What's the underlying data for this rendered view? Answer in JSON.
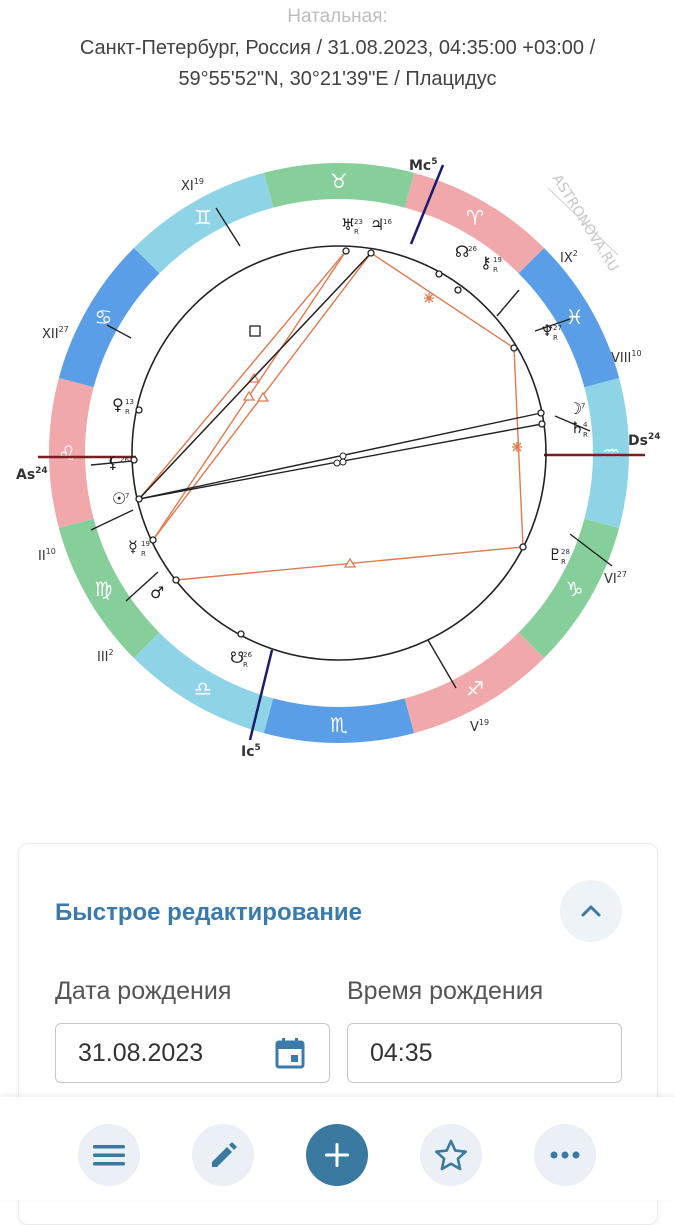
{
  "header": {
    "kind": "Натальная:",
    "line1": "Санкт-Петербург, Россия / 31.08.2023, 04:35:00 +03:00 /",
    "line2": "59°55'52\"N, 30°21'39\"E / Плацидус"
  },
  "chart": {
    "watermark": "ASTRONOVA.RU",
    "axes": {
      "as": {
        "label": "As",
        "deg": "24"
      },
      "ds": {
        "label": "Ds",
        "deg": "24"
      },
      "mc": {
        "label": "Mc",
        "deg": "5"
      },
      "ic": {
        "label": "Ic",
        "deg": "5"
      }
    },
    "houses": [
      {
        "num": "II",
        "deg": "10"
      },
      {
        "num": "III",
        "deg": "2"
      },
      {
        "num": "V",
        "deg": "19"
      },
      {
        "num": "VI",
        "deg": "27"
      },
      {
        "num": "VIII",
        "deg": "10"
      },
      {
        "num": "IX",
        "deg": "2"
      },
      {
        "num": "XI",
        "deg": "19"
      },
      {
        "num": "XII",
        "deg": "27"
      }
    ],
    "signs": [
      {
        "glyph": "♈",
        "color": "#f0a8aa"
      },
      {
        "glyph": "♉",
        "color": "#86cf9a"
      },
      {
        "glyph": "♊",
        "color": "#8fd4e6"
      },
      {
        "glyph": "♋",
        "color": "#5b9ee8"
      },
      {
        "glyph": "♌",
        "color": "#f0a8aa"
      },
      {
        "glyph": "♍",
        "color": "#86cf9a"
      },
      {
        "glyph": "♎",
        "color": "#8fd4e6"
      },
      {
        "glyph": "♏",
        "color": "#5b9ee8"
      },
      {
        "glyph": "♐",
        "color": "#f0a8aa"
      },
      {
        "glyph": "♑",
        "color": "#86cf9a"
      },
      {
        "glyph": "♒",
        "color": "#8fd4e6"
      },
      {
        "glyph": "♓",
        "color": "#5b9ee8"
      }
    ],
    "planets": [
      {
        "name": "uranus",
        "glyph": "♅",
        "deg": "23",
        "retro": "R"
      },
      {
        "name": "jupiter",
        "glyph": "♃",
        "deg": "16",
        "retro": ""
      },
      {
        "name": "node",
        "glyph": "☊",
        "deg": "26",
        "retro": ""
      },
      {
        "name": "chiron",
        "glyph": "⚷",
        "deg": "19",
        "retro": "R"
      },
      {
        "name": "neptune",
        "glyph": "♆",
        "deg": "27",
        "retro": "R"
      },
      {
        "name": "moon",
        "glyph": "☽",
        "deg": "7",
        "retro": ""
      },
      {
        "name": "saturn",
        "glyph": "♄",
        "deg": "4",
        "retro": "R"
      },
      {
        "name": "pluto",
        "glyph": "♇",
        "deg": "28",
        "retro": "R"
      },
      {
        "name": "venus",
        "glyph": "♀",
        "deg": "13",
        "retro": "R"
      },
      {
        "name": "lilith",
        "glyph": "⚸",
        "deg": "26",
        "retro": ""
      },
      {
        "name": "sun",
        "glyph": "☉",
        "deg": "7",
        "retro": ""
      },
      {
        "name": "mercury",
        "glyph": "☿",
        "deg": "19",
        "retro": "R"
      },
      {
        "name": "mars",
        "glyph": "♂",
        "deg": "",
        "retro": ""
      },
      {
        "name": "south-node",
        "glyph": "☋",
        "deg": "26",
        "retro": "R"
      }
    ],
    "colors": {
      "aspect": "#e07a50",
      "axis": "#7a1f1f",
      "mc": "#1c1c6e"
    }
  },
  "quick_edit": {
    "title": "Быстрое редактирование",
    "date_label": "Дата рождения",
    "date_value": "31.08.2023",
    "time_label": "Время рождения",
    "time_value": "04:35"
  }
}
